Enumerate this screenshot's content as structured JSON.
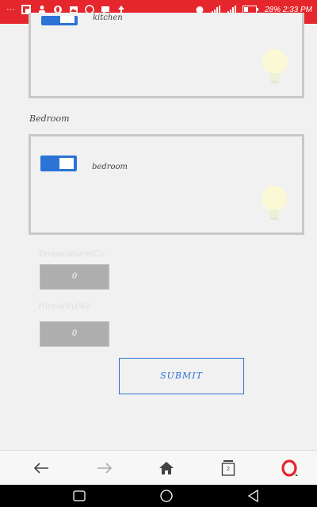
{
  "status_bar": {
    "right_text": "28% 2:33 PM",
    "icons": [
      "more-icon",
      "flipboard-icon",
      "person-icon",
      "opera-icon",
      "gallery-icon",
      "whatsapp-icon",
      "message-icon",
      "upload-icon",
      "alarm-icon",
      "signal-icon",
      "signal2-icon",
      "battery-icon"
    ]
  },
  "rooms": [
    {
      "label": "kitchen",
      "toggle_on": true
    },
    {
      "label": "bedroom",
      "toggle_on": true
    }
  ],
  "section_title": "Bedroom",
  "temperature": {
    "label": "Temperature(C):",
    "value": "0"
  },
  "humidity": {
    "label": "Humidity(%):",
    "value": "0"
  },
  "submit_label": "SUBMIT",
  "browser": {
    "icons": [
      "back-arrow-icon",
      "forward-arrow-icon",
      "home-icon",
      "tabs-icon",
      "opera-icon"
    ],
    "tab_count": "2"
  },
  "colors": {
    "accent": "#2b73d6",
    "statusbar": "#e5262c",
    "opera": "#e5262c"
  }
}
